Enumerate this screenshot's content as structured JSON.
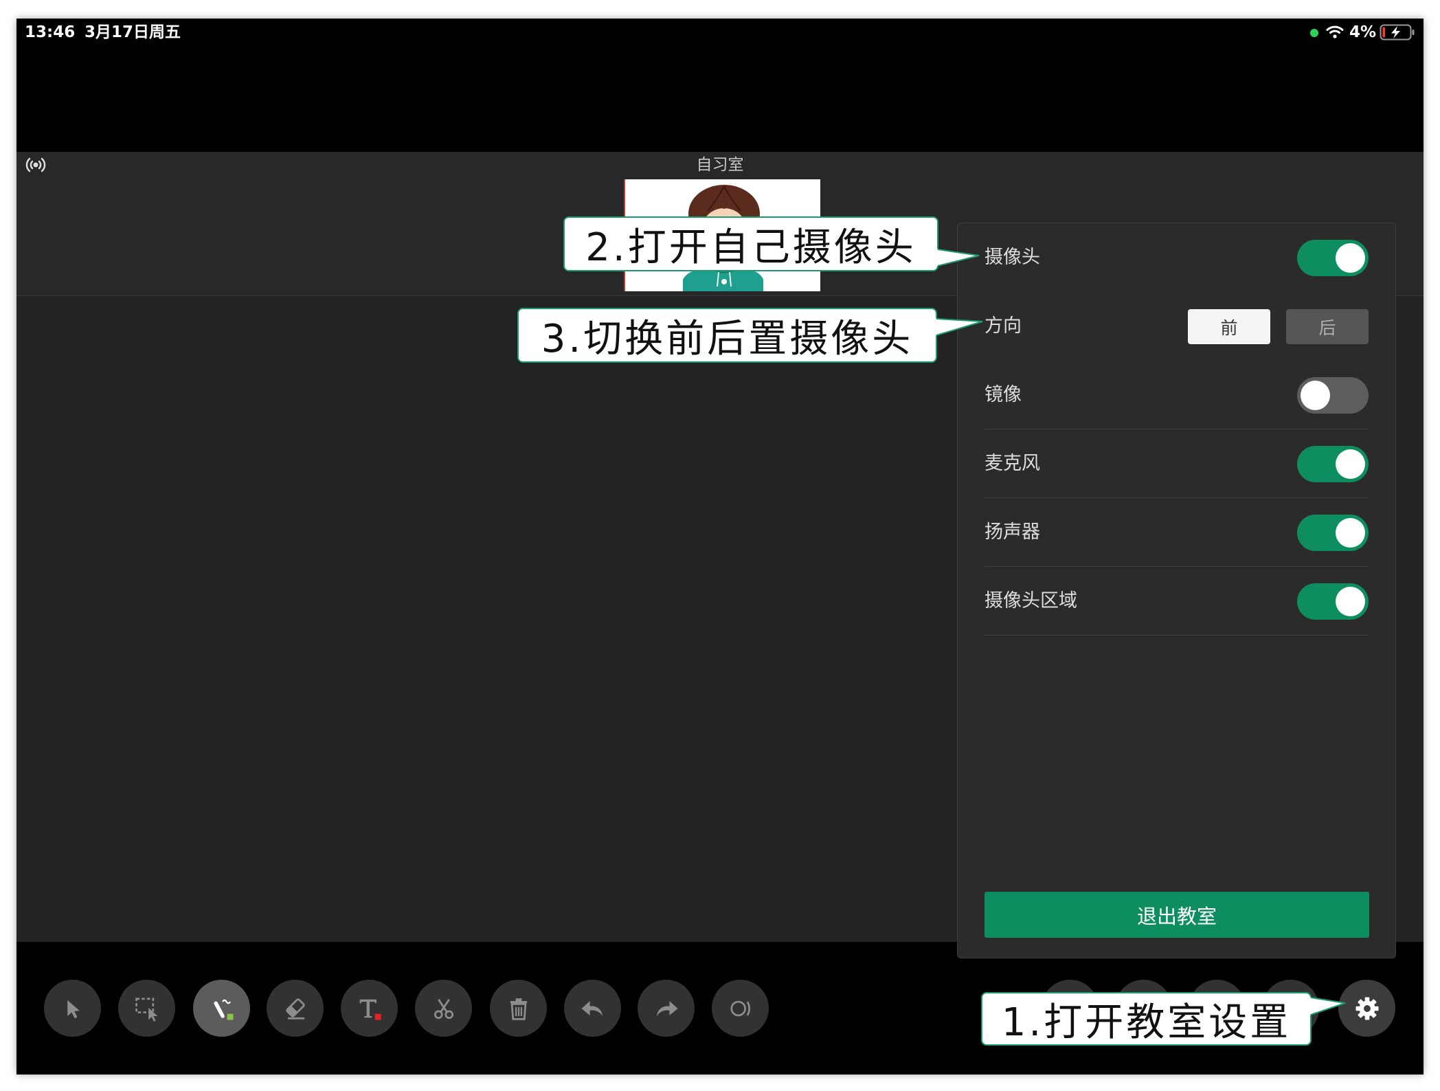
{
  "status_bar": {
    "time": "13:46",
    "date": "3月17日周五",
    "battery": "4%",
    "icons": [
      "camera-in-use-indicator",
      "wifi-icon",
      "battery-charging-icon"
    ]
  },
  "room_title": "自习室",
  "header_icon": "broadcast-icon",
  "settings_panel": {
    "rows": [
      {
        "label": "摄像头",
        "toggle_on": true
      },
      {
        "label": "方向",
        "options": [
          {
            "label": "前",
            "selected": true
          },
          {
            "label": "后",
            "selected": false
          }
        ]
      },
      {
        "label": "镜像",
        "toggle_on": false
      },
      {
        "label": "麦克风",
        "toggle_on": true
      },
      {
        "label": "扬声器",
        "toggle_on": true
      },
      {
        "label": "摄像头区域",
        "toggle_on": true
      }
    ],
    "exit_label": "退出教室"
  },
  "toolbar": {
    "tools": [
      {
        "icon": "select-icon",
        "active": false
      },
      {
        "icon": "area-select-icon",
        "active": false
      },
      {
        "icon": "pen-icon",
        "active": true
      },
      {
        "icon": "eraser-icon",
        "active": false
      },
      {
        "icon": "text-icon",
        "active": false
      },
      {
        "icon": "scissors-icon",
        "active": false
      },
      {
        "icon": "trash-icon",
        "active": false
      },
      {
        "icon": "undo-icon",
        "active": false
      },
      {
        "icon": "redo-icon",
        "active": false
      },
      {
        "icon": "circle-shape-icon",
        "active": false
      }
    ],
    "settings_icon": "gear-icon"
  },
  "annotations": [
    {
      "text": "1.打开教室设置"
    },
    {
      "text": "2.打开自己摄像头"
    },
    {
      "text": "3.切换前后置摄像头"
    }
  ],
  "colors": {
    "accent_green": "#0e8e5e",
    "callout_border": "#1c9b6c",
    "toggle_off": "#5d5d5d",
    "camera_indicator": "#30d158",
    "battery_low": "#ff3b30",
    "pen_color": "#8bc34a",
    "text_color": "#e8222b"
  }
}
